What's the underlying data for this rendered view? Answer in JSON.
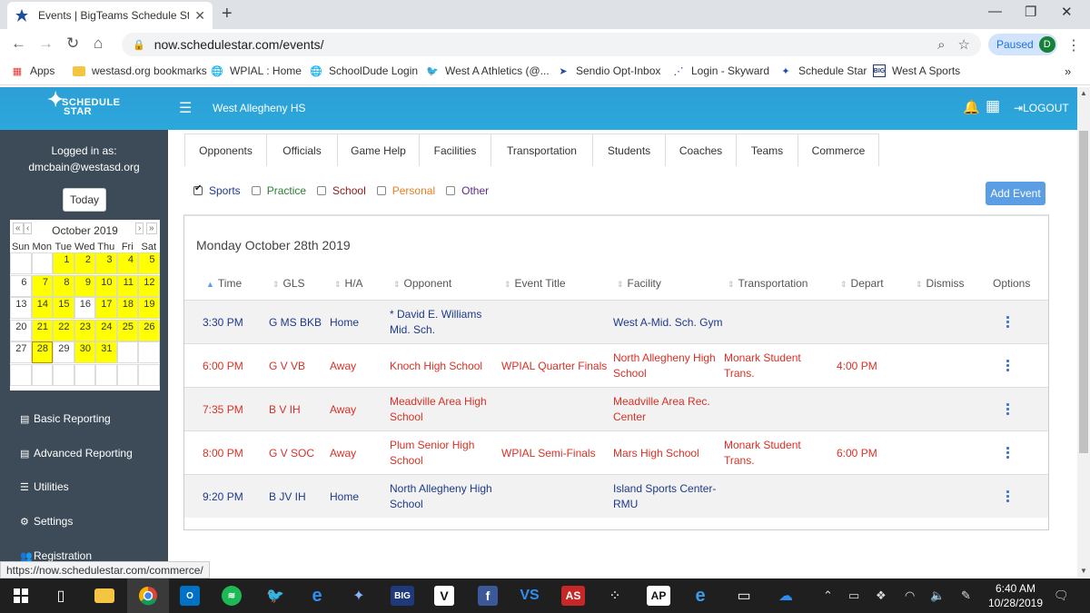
{
  "browser": {
    "tab_title": "Events | BigTeams Schedule Star",
    "url": "now.schedulestar.com/events/",
    "profile_status": "Paused",
    "profile_initial": "D",
    "bookmarks": [
      "Apps",
      "westasd.org bookmarks",
      "WPIAL : Home",
      "SchoolDude Login",
      "West A Athletics (@...",
      "Sendio Opt-Inbox",
      "Login - Skyward",
      "Schedule Star",
      "West A Sports"
    ],
    "status_url": "https://now.schedulestar.com/commerce/"
  },
  "header": {
    "logo_line1": "SCHEDULE",
    "logo_line2": "STAR",
    "school": "West Allegheny HS",
    "logout_label": "LOGOUT"
  },
  "sidebar": {
    "logged_in_label": "Logged in as:",
    "user": "dmcbain@westasd.org",
    "today_button": "Today",
    "calendar": {
      "title": "October 2019",
      "prev_year": "«",
      "prev_month": "‹",
      "next_month": "›",
      "next_year": "»",
      "weekdays": [
        "Sun",
        "Mon",
        "Tue",
        "Wed",
        "Thu",
        "Fri",
        "Sat"
      ],
      "weeks": [
        [
          "",
          "",
          "1",
          "2",
          "3",
          "4",
          "5"
        ],
        [
          "6",
          "7",
          "8",
          "9",
          "10",
          "11",
          "12"
        ],
        [
          "13",
          "14",
          "15",
          "16",
          "17",
          "18",
          "19"
        ],
        [
          "20",
          "21",
          "22",
          "23",
          "24",
          "25",
          "26"
        ],
        [
          "27",
          "28",
          "29",
          "30",
          "31",
          "",
          ""
        ],
        [
          "",
          "",
          "",
          "",
          "",
          "",
          ""
        ]
      ],
      "highlighted_days": [
        1,
        2,
        3,
        4,
        5,
        7,
        8,
        9,
        10,
        11,
        12,
        14,
        15,
        17,
        18,
        19,
        21,
        22,
        23,
        24,
        25,
        26,
        28,
        30,
        31
      ],
      "selected_day": 28
    },
    "links": [
      "Basic Reporting",
      "Advanced Reporting",
      "Utilities",
      "Settings",
      "Registration"
    ]
  },
  "tabs": [
    "Opponents",
    "Officials",
    "Game Help",
    "Facilities",
    "Transportation",
    "Students",
    "Coaches",
    "Teams",
    "Commerce"
  ],
  "filters": [
    {
      "label": "Sports",
      "checked": true,
      "color": "#1e3a8a"
    },
    {
      "label": "Practice",
      "checked": false,
      "color": "#2e7d32"
    },
    {
      "label": "School",
      "checked": false,
      "color": "#8b1a1a"
    },
    {
      "label": "Personal",
      "checked": false,
      "color": "#e67e22"
    },
    {
      "label": "Other",
      "checked": false,
      "color": "#5b2c83"
    }
  ],
  "add_event_label": "Add Event",
  "day_title": "Monday October 28th 2019",
  "columns": [
    "Time",
    "GLS",
    "H/A",
    "Opponent",
    "Event Title",
    "Facility",
    "Transportation",
    "Depart",
    "Dismiss",
    "Options"
  ],
  "events": [
    {
      "time": "3:30 PM",
      "gls": "G MS BKB",
      "ha": "Home",
      "opponent": [
        "* David E. Williams",
        "Mid. Sch."
      ],
      "title": "",
      "facility": [
        "West A-Mid. Sch. Gym"
      ],
      "transport": [],
      "depart": "",
      "dismiss": "",
      "color": "blue"
    },
    {
      "time": "6:00 PM",
      "gls": "G V VB",
      "ha": "Away",
      "opponent": [
        "Knoch High School"
      ],
      "title": "WPIAL Quarter Finals",
      "facility": [
        "North Allegheny High",
        "School"
      ],
      "transport": [
        "Monark Student",
        "Trans."
      ],
      "depart": "4:00 PM",
      "dismiss": "",
      "color": "red"
    },
    {
      "time": "7:35 PM",
      "gls": "B V IH",
      "ha": "Away",
      "opponent": [
        "Meadville Area High",
        "School"
      ],
      "title": "",
      "facility": [
        "Meadville Area Rec.",
        "Center"
      ],
      "transport": [],
      "depart": "",
      "dismiss": "",
      "color": "red"
    },
    {
      "time": "8:00 PM",
      "gls": "G V SOC",
      "ha": "Away",
      "opponent": [
        "Plum Senior High",
        "School"
      ],
      "title": "WPIAL Semi-Finals",
      "facility": [
        "Mars High School"
      ],
      "transport": [
        "Monark Student",
        "Trans."
      ],
      "depart": "6:00 PM",
      "dismiss": "",
      "color": "red"
    },
    {
      "time": "9:20 PM",
      "gls": "B JV IH",
      "ha": "Home",
      "opponent": [
        "North Allegheny High",
        "School"
      ],
      "title": "",
      "facility": [
        "Island Sports Center-",
        "RMU"
      ],
      "transport": [],
      "depart": "",
      "dismiss": "",
      "color": "blue"
    }
  ],
  "taskbar": {
    "time": "6:40 AM",
    "date": "10/28/2019"
  },
  "colors": {
    "header_blue": "#2ba8dc",
    "sidebar": "#3c4b57",
    "calendar_highlight": "#ffff00",
    "away_red": "#d93025",
    "home_blue": "#1e3a8a",
    "button_blue": "#5b9ee3"
  }
}
